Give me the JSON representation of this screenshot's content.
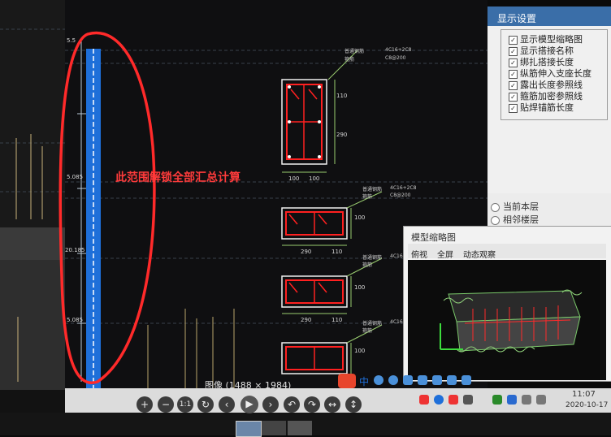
{
  "annotation": {
    "note": "此范围解锁全部汇总计算"
  },
  "settings_panel": {
    "title": "显示设置",
    "items": [
      {
        "label": "显示模型缩略图",
        "checked": true
      },
      {
        "label": "显示搭接名称",
        "checked": true
      },
      {
        "label": "绑扎搭接长度",
        "checked": true
      },
      {
        "label": "纵筋伸入支座长度",
        "checked": true
      },
      {
        "label": "露出长度参照线",
        "checked": true
      },
      {
        "label": "箍筋加密参照线",
        "checked": true
      },
      {
        "label": "贴焊锚筋长度",
        "checked": true
      }
    ],
    "floor_options": [
      {
        "label": "当前本层",
        "selected": false
      },
      {
        "label": "相邻楼层",
        "selected": false
      }
    ]
  },
  "thumbnail_panel": {
    "title": "模型缩略图",
    "tabs": [
      "俯视",
      "全屏",
      "动态观察"
    ]
  },
  "cad_labels": {
    "left_marks": [
      "5.5",
      "5.085",
      "20.185",
      "5.085"
    ],
    "dims_a": [
      "100",
      "100"
    ],
    "dims_b": [
      "290",
      "110"
    ],
    "dims_c": [
      "290",
      "110"
    ],
    "side_dims_a": [
      "110",
      "290"
    ],
    "side_dims_b": [
      "100",
      "100",
      "100"
    ],
    "tags": [
      "4C16+2C8",
      "C8@200",
      "4C16+2C8",
      "C8@200",
      "4C16",
      "4C16"
    ],
    "tiny_labels": [
      "普通钢筋",
      "箍筋",
      "普通钢筋",
      "箍筋",
      "普通钢筋",
      "箍筋",
      "普通钢筋",
      "箍筋"
    ]
  },
  "image_caption": "图像 (1488 × 1984)",
  "viewer_toolbar": {
    "buttons": [
      "+",
      "−",
      "1:1",
      "↻",
      "‹",
      "▶",
      "›",
      "↶",
      "↷",
      "↔",
      "↕"
    ]
  },
  "taskbar": {
    "time": "11:07",
    "date": "2020-10-17",
    "ime_label": "中"
  },
  "colors": {
    "accent": "#3a6ea8",
    "annotation": "#ff2a2a",
    "rebar": "#ff2020",
    "column": "#1e6fd9"
  }
}
